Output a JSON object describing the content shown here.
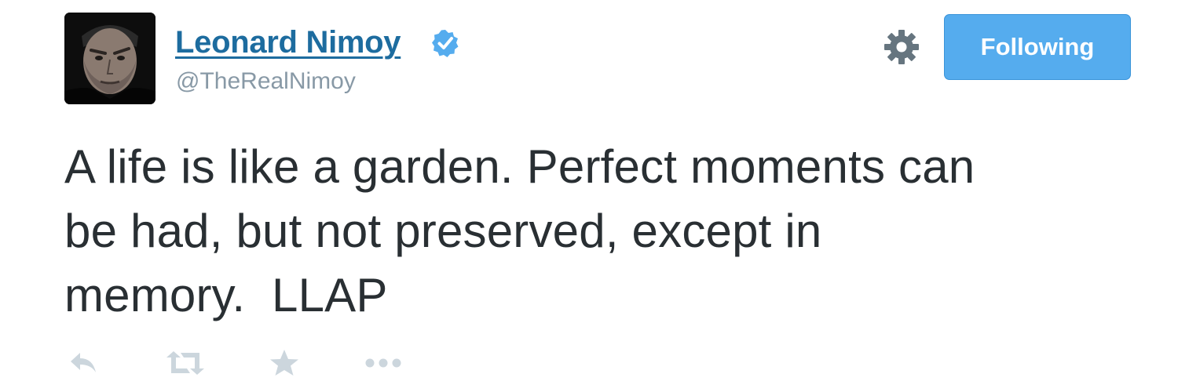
{
  "user": {
    "name": "Leonard Nimoy",
    "handle": "@TheRealNimoy",
    "verified": true
  },
  "follow_button": {
    "label": "Following"
  },
  "tweet": {
    "text": "A life is like a garden. Perfect moments can\nbe had, but not preserved, except in\nmemory.  LLAP"
  },
  "actions": [
    "reply-icon",
    "retweet-icon",
    "favorite-icon",
    "more-icon"
  ],
  "colors": {
    "name_link": "#1d6c9f",
    "handle": "#8899a6",
    "follow_button_bg": "#55acee",
    "verified_badge": "#55acee",
    "action_icons": "#ccd6dd",
    "gear_icon": "#66757f",
    "tweet_text": "#292f33"
  }
}
